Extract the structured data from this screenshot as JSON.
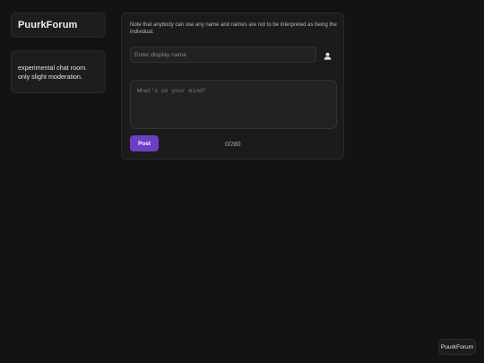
{
  "brand": {
    "title": "PuurkForum"
  },
  "sidebar": {
    "description": "experimental chat room. only slight moderation."
  },
  "composer": {
    "note": "Note that anybody can use any name and names are not to be interpreted as being the individual.",
    "name_placeholder": "Enter display name",
    "name_value": "",
    "message_placeholder": "What's on your mind?",
    "message_value": "",
    "post_label": "Post",
    "counter": "0/280",
    "user_icon": "user-icon",
    "accent_color": "#6a3fc4"
  },
  "footer": {
    "badge_label": "PuurkForum"
  }
}
